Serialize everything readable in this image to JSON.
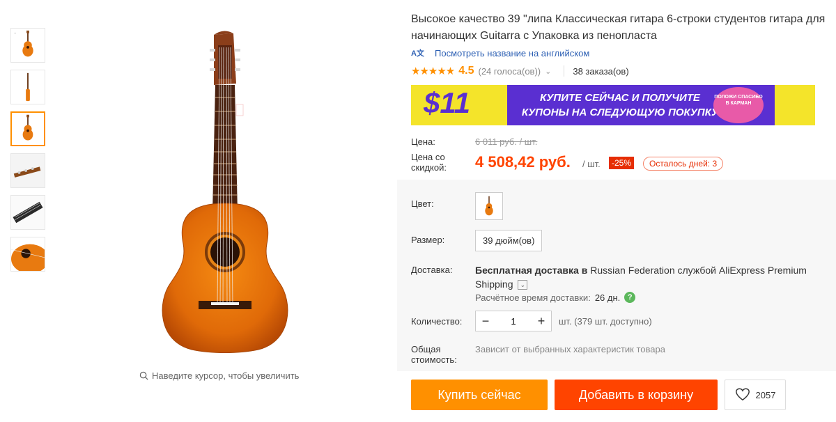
{
  "gallery": {
    "thumbnails": [
      "guitar-front-small",
      "guitar-side",
      "guitar-front",
      "guitar-headstock",
      "guitar-neck",
      "guitar-body-detail"
    ],
    "active_index": 2,
    "zoom_hint": "Наведите курсор, чтобы увеличить"
  },
  "product": {
    "title": "Высокое качество 39 \"липа Классическая гитара 6-строки студентов гитара для начинающих Guitarra с Упаковка из пенопласта",
    "translate_badge": "A文",
    "translate_link": "Посмотреть название на английском",
    "rating_stars": "★★★★★",
    "rating_value": "4.5",
    "votes": "(24 голоса(ов))",
    "orders": "38 заказа(ов)"
  },
  "banner": {
    "amount": "$11",
    "text": "КУПИТЕ СЕЙЧАС И ПОЛУЧИТЕ КУПОНЫ НА СЛЕДУЮЩУЮ ПОКУПКУ",
    "seal_text": "ПОЛОЖИ СПАСИБО В КАРМАН"
  },
  "price": {
    "label": "Цена:",
    "old": "6 011 руб. / шт.",
    "discount_label": "Цена со скидкой:",
    "new": "4 508,42 руб.",
    "per_unit": "/ шт.",
    "discount_badge": "-25%",
    "days_left": "Осталось дней: 3"
  },
  "options": {
    "color_label": "Цвет:",
    "size_label": "Размер:",
    "size_value": "39 дюйм(ов)",
    "delivery_label": "Доставка:",
    "delivery_bold": "Бесплатная доставка в",
    "delivery_rest": "Russian Federation службой AliExpress Premium Shipping",
    "delivery_time_label": "Расчётное время доставки:",
    "delivery_time_value": "26 дн.",
    "quantity_label": "Количество:",
    "quantity_value": "1",
    "quantity_note": "шт. (379 шт. доступно)",
    "total_label": "Общая стоимость:",
    "total_note": "Зависит от выбранных характеристик товара"
  },
  "actions": {
    "buy_now": "Купить сейчас",
    "add_to_cart": "Добавить в корзину",
    "wishlist_count": "2057"
  },
  "colors": {
    "accent_orange": "#ff9000",
    "price_red": "#ff4400",
    "banner_purple": "#5a2fd1",
    "banner_yellow": "#f4e42a"
  }
}
